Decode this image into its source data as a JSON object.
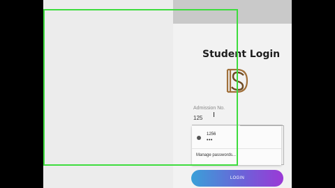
{
  "login": {
    "title": "Student Login",
    "logo_letters": "DS",
    "field_label": "Admission No.",
    "field_value": "125",
    "button_label": "LOGIN"
  },
  "autofill": {
    "suggestion_user": "1256",
    "suggestion_password": "•••",
    "manage_label": "Manage passwords..."
  },
  "colors": {
    "button_gradient_start": "#3aa0d8",
    "button_gradient_end": "#9b39d6",
    "recording_frame": "#3ddc3d",
    "logo_color": "#a0703a"
  },
  "icons": {
    "text_cursor": "text-cursor-icon",
    "key": "key-icon"
  }
}
